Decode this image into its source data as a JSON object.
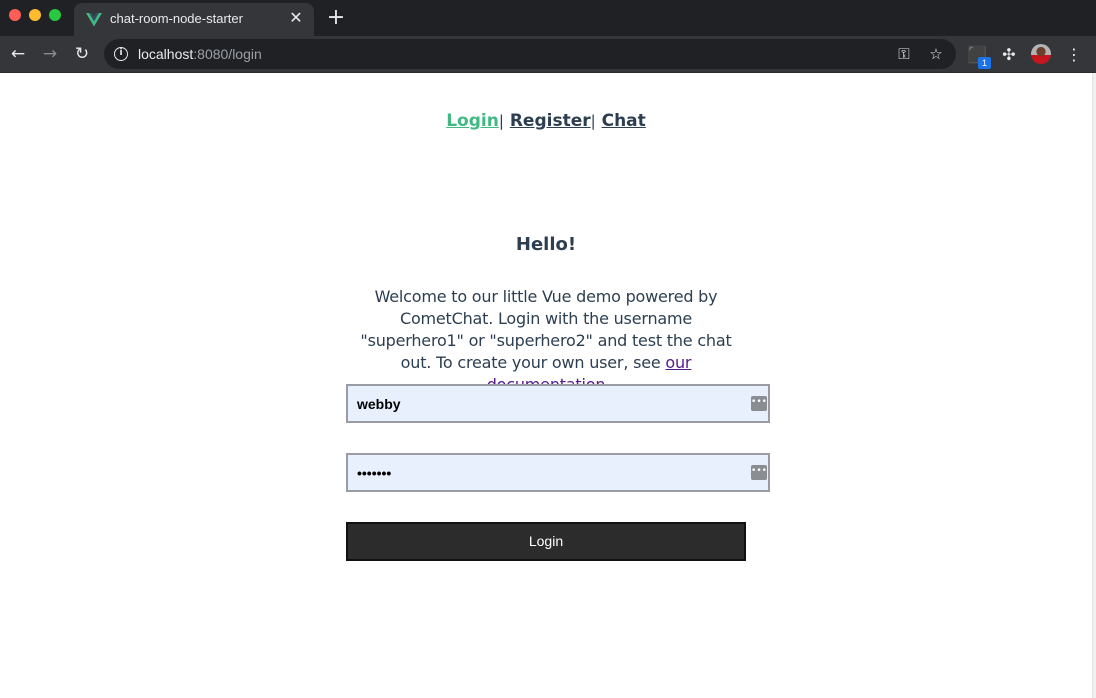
{
  "browser": {
    "tab_title": "chat-room-node-starter",
    "close_glyph": "✕",
    "new_tab_glyph": "+",
    "url_host": "localhost",
    "url_rest": ":8080/login",
    "extension_badge": "1",
    "icons": [
      "vue-logo-icon",
      "info-icon",
      "key-icon",
      "star-icon",
      "extension-cube-icon",
      "puzzle-icon",
      "profile-avatar",
      "menu-dots-icon"
    ]
  },
  "nav": {
    "links": [
      {
        "label": "Login",
        "active": true
      },
      {
        "label": "Register",
        "active": false
      },
      {
        "label": "Chat",
        "active": false
      }
    ],
    "separator": "|"
  },
  "main": {
    "heading": "Hello!",
    "welcome_text": "Welcome to our little Vue demo powered by CometChat. Login with the username \"superhero1\" or \"superhero2\" and test the chat out. To create your own user, see ",
    "doc_link": "our documentation",
    "username_value": "webby",
    "password_value": "•••••••",
    "login_button": "Login"
  },
  "colors": {
    "active_link": "#42b983",
    "text": "#2c3e50",
    "autofill_bg": "#e8f0fe",
    "button_bg": "#2c2c2c",
    "visited_link": "#551a8b"
  }
}
